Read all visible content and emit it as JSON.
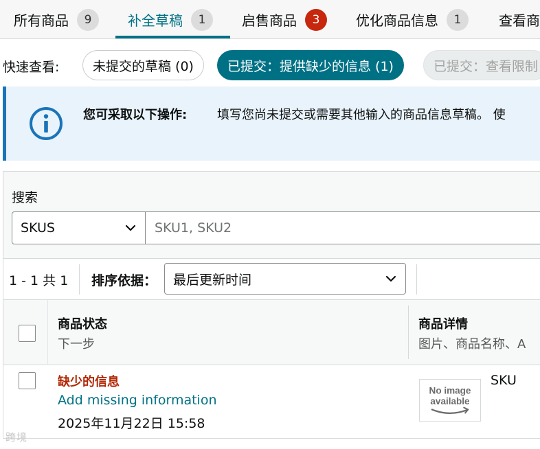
{
  "tabs": [
    {
      "label": "所有商品",
      "count": "9"
    },
    {
      "label": "补全草稿",
      "count": "1"
    },
    {
      "label": "启售商品",
      "count": "3"
    },
    {
      "label": "优化商品信息",
      "count": "1"
    },
    {
      "label": "查看商"
    }
  ],
  "quick_view": {
    "label": "快速查看:",
    "filters": [
      "未提交的草稿 (0)",
      "已提交：提供缺少的信息 (1)",
      "已提交：查看限制"
    ]
  },
  "banner": {
    "title": "您可采取以下操作:",
    "text": "填写您尚未提交或需要其他输入的商品信息草稿。 使"
  },
  "search": {
    "label": "搜索",
    "field_type": "SKUS",
    "placeholder": "SKU1, SKU2"
  },
  "sort": {
    "range": "1 - 1 共 1",
    "label": "排序依据：",
    "value": "最后更新时间"
  },
  "table": {
    "columns": [
      {
        "title": "商品状态",
        "subtitle": "下一步"
      },
      {
        "title": "商品详情",
        "subtitle": "图片、商品名称、A"
      }
    ],
    "rows": [
      {
        "status": "缺少的信息",
        "action": "Add missing information",
        "updated": "2025年11月22日 15:58",
        "image_text": [
          "No image",
          "available"
        ],
        "sku_label": "SKU"
      }
    ]
  },
  "watermark": "跨境",
  "colors": {
    "accent": "#007185",
    "alert": "#c7270c",
    "status_text": "#b12704",
    "banner_bg": "#e9f3fb",
    "banner_border": "#1a74b8"
  }
}
